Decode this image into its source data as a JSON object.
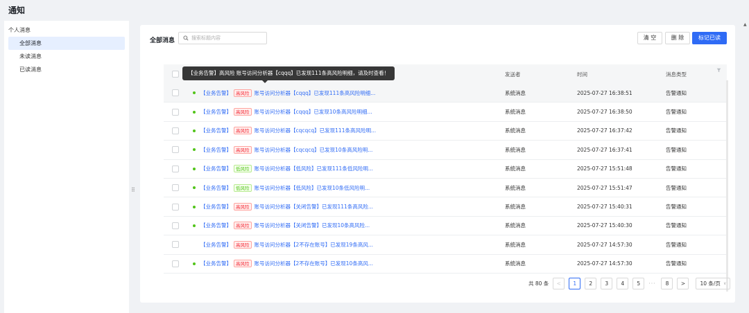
{
  "page": {
    "title": "通知"
  },
  "sidebar": {
    "group_label": "个人消息",
    "items": [
      {
        "label": "全部消息",
        "active": true
      },
      {
        "label": "未读消息",
        "active": false
      },
      {
        "label": "已读消息",
        "active": false
      }
    ]
  },
  "toolbar": {
    "title": "全部消息",
    "search_placeholder": "搜索标题内容",
    "clear_label": "清 空",
    "delete_label": "删 除",
    "mark_read_label": "标记已读"
  },
  "tooltip": {
    "text": "【业务告警】高风险 账号访问分析器【cqqq】已发现111条高风险明细，请及时查看！"
  },
  "table": {
    "columns": {
      "sender": "发送者",
      "time": "时间",
      "type": "消息类型"
    },
    "rows": [
      {
        "unread": true,
        "category": "【业务告警】",
        "risk": "高风险",
        "risk_level": "high",
        "message": "账号访问分析器【cqqq】已发现111条高风险明细...",
        "sender": "系统消息",
        "time": "2025-07-27 16:38:51",
        "type": "告警通知"
      },
      {
        "unread": true,
        "category": "【业务告警】",
        "risk": "高风险",
        "risk_level": "high",
        "message": "账号访问分析器【cqqq】已发现10条高风险明细...",
        "sender": "系统消息",
        "time": "2025-07-27 16:38:50",
        "type": "告警通知"
      },
      {
        "unread": true,
        "category": "【业务告警】",
        "risk": "高风险",
        "risk_level": "high",
        "message": "账号访问分析器【cqcqcq】已发现111条高风险明...",
        "sender": "系统消息",
        "time": "2025-07-27 16:37:42",
        "type": "告警通知"
      },
      {
        "unread": true,
        "category": "【业务告警】",
        "risk": "高风险",
        "risk_level": "high",
        "message": "账号访问分析器【cqcqcq】已发现10条高风险明...",
        "sender": "系统消息",
        "time": "2025-07-27 16:37:41",
        "type": "告警通知"
      },
      {
        "unread": true,
        "category": "【业务告警】",
        "risk": "低风险",
        "risk_level": "low",
        "message": "账号访问分析器【低风险】已发现111条低风险明...",
        "sender": "系统消息",
        "time": "2025-07-27 15:51:48",
        "type": "告警通知"
      },
      {
        "unread": true,
        "category": "【业务告警】",
        "risk": "低风险",
        "risk_level": "low",
        "message": "账号访问分析器【低风险】已发现10条低风险明...",
        "sender": "系统消息",
        "time": "2025-07-27 15:51:47",
        "type": "告警通知"
      },
      {
        "unread": true,
        "category": "【业务告警】",
        "risk": "高风险",
        "risk_level": "high",
        "message": "账号访问分析器【关闭告警】已发现111条高风险...",
        "sender": "系统消息",
        "time": "2025-07-27 15:40:31",
        "type": "告警通知"
      },
      {
        "unread": true,
        "category": "【业务告警】",
        "risk": "高风险",
        "risk_level": "high",
        "message": "账号访问分析器【关闭告警】已发现10条高风险...",
        "sender": "系统消息",
        "time": "2025-07-27 15:40:30",
        "type": "告警通知"
      },
      {
        "unread": false,
        "category": "【业务告警】",
        "risk": "高风险",
        "risk_level": "high",
        "message": "账号访问分析器【2不存在账号】已发现19条高风...",
        "sender": "系统消息",
        "time": "2025-07-27 14:57:30",
        "type": "告警通知"
      },
      {
        "unread": true,
        "category": "【业务告警】",
        "risk": "高风险",
        "risk_level": "high",
        "message": "账号访问分析器【2不存在账号】已发现10条高风...",
        "sender": "系统消息",
        "time": "2025-07-27 14:57:30",
        "type": "告警通知"
      }
    ]
  },
  "pagination": {
    "total_label": "共 80 条",
    "pages": [
      "1",
      "2",
      "3",
      "4",
      "5"
    ],
    "current": "1",
    "ellipsis": "···",
    "last": "8",
    "page_size": "10 条/页",
    "prev": "<",
    "next": ">"
  },
  "colors": {
    "accent": "#2f6bf5",
    "high_risk": "#f5222d",
    "low_risk": "#52c41a",
    "unread_dot": "#52c41a"
  }
}
